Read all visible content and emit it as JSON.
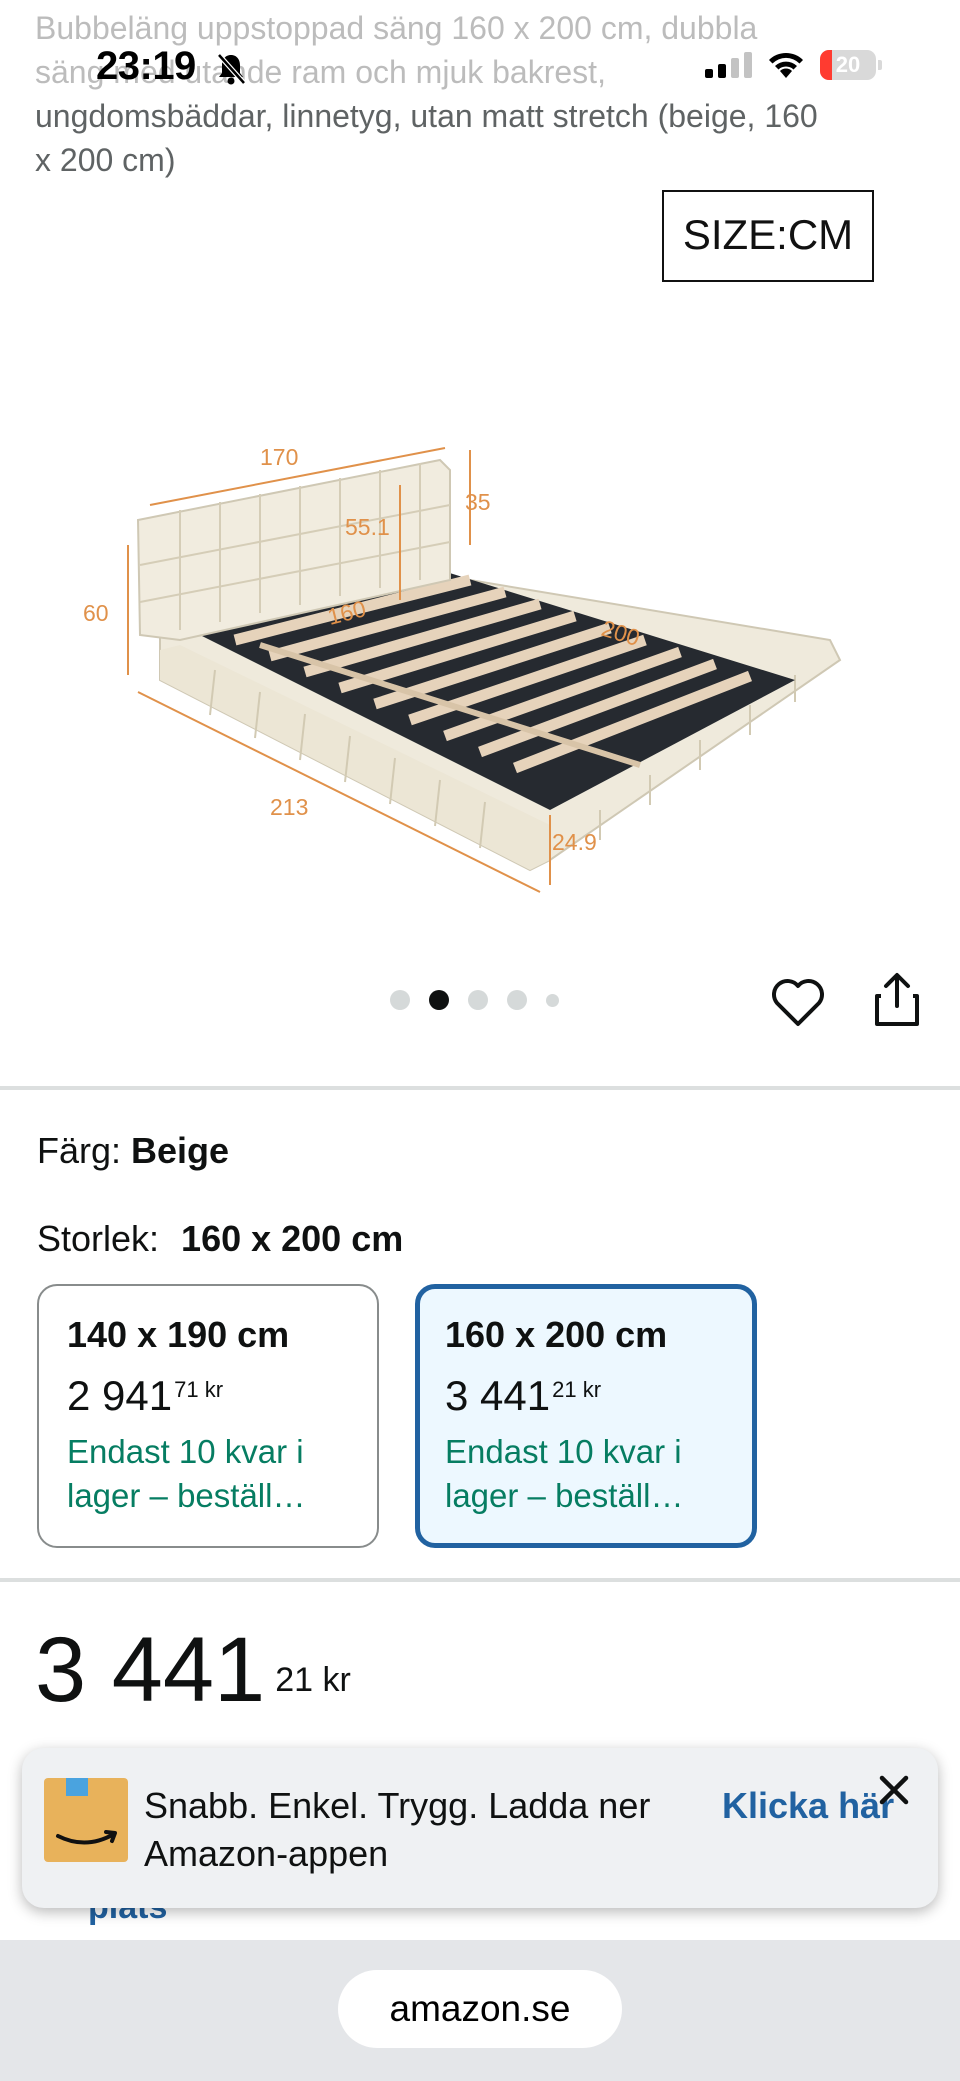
{
  "product": {
    "title_line1": "Bubbeläng uppstoppad säng 160 x 200 cm, dubbla",
    "title_line2": "säng med utande ram och mjuk bakrest,",
    "title_line3": "ungdomsbäddar, linnetyg, utan matt stretch (beige, 160",
    "title_line4": "x 200 cm)"
  },
  "status_bar": {
    "time": "23:19",
    "battery": "20",
    "icons": [
      "bell-slash-icon",
      "signal-icon",
      "wifi-icon",
      "battery-icon"
    ]
  },
  "gallery": {
    "size_tag": "SIZE:CM",
    "dimensions": {
      "width_top": "170",
      "headboard_height": "35",
      "headboard_inner": "55.1",
      "total_height": "60",
      "inner_width": "160",
      "inner_length": "200",
      "total_length": "213",
      "frame_height": "24.9"
    },
    "dots_total": 5,
    "active_dot": 2
  },
  "selection": {
    "color_label": "Färg:",
    "color_value": "Beige",
    "size_label": "Storlek:",
    "size_value": "160 x 200 cm"
  },
  "variants": [
    {
      "size": "140 x 190 cm",
      "price_whole": "2 941",
      "price_frac": "71 kr",
      "stock": "Endast 10 kvar i lager – beställ…",
      "selected": false
    },
    {
      "size": "160 x 200 cm",
      "price_whole": "3 441",
      "price_frac": "21 kr",
      "stock": "Endast 10 kvar i lager – beställ…",
      "selected": true
    }
  ],
  "price": {
    "whole": "3 441",
    "frac": "21 kr"
  },
  "behind_banner_text": "plats",
  "app_banner": {
    "text": "Snabb. Enkel. Trygg. Ladda ner Amazon-appen",
    "cta": "Klicka här"
  },
  "browser": {
    "url": "amazon.se"
  },
  "colors": {
    "selected_border": "#2162a1",
    "selected_bg": "#edf8ff",
    "stock_green": "#067d62",
    "link_blue": "#2162a1",
    "dimension_orange": "#e0914a"
  }
}
